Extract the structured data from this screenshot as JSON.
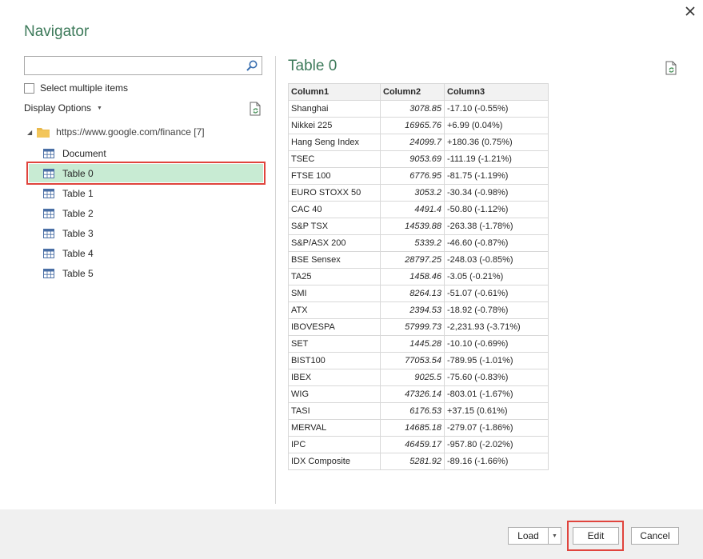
{
  "dialog": {
    "title": "Navigator",
    "close_glyph": "✕"
  },
  "left_pane": {
    "search": {
      "value": "",
      "placeholder": ""
    },
    "select_multiple_label": "Select multiple items",
    "display_options_label": "Display Options",
    "tree": {
      "root_label": "https://www.google.com/finance [7]",
      "items": [
        {
          "label": "Document"
        },
        {
          "label": "Table 0",
          "selected": true
        },
        {
          "label": "Table 1"
        },
        {
          "label": "Table 2"
        },
        {
          "label": "Table 3"
        },
        {
          "label": "Table 4"
        },
        {
          "label": "Table 5"
        }
      ]
    }
  },
  "preview": {
    "title": "Table 0",
    "columns": [
      "Column1",
      "Column2",
      "Column3"
    ],
    "rows": [
      [
        "Shanghai",
        "3078.85",
        "-17.10 (-0.55%)"
      ],
      [
        "Nikkei 225",
        "16965.76",
        "+6.99 (0.04%)"
      ],
      [
        "Hang Seng Index",
        "24099.7",
        "+180.36 (0.75%)"
      ],
      [
        "TSEC",
        "9053.69",
        "-111.19 (-1.21%)"
      ],
      [
        "FTSE 100",
        "6776.95",
        "-81.75 (-1.19%)"
      ],
      [
        "EURO STOXX 50",
        "3053.2",
        "-30.34 (-0.98%)"
      ],
      [
        "CAC 40",
        "4491.4",
        "-50.80 (-1.12%)"
      ],
      [
        "S&P TSX",
        "14539.88",
        "-263.38 (-1.78%)"
      ],
      [
        "S&P/ASX 200",
        "5339.2",
        "-46.60 (-0.87%)"
      ],
      [
        "BSE Sensex",
        "28797.25",
        "-248.03 (-0.85%)"
      ],
      [
        "TA25",
        "1458.46",
        "-3.05 (-0.21%)"
      ],
      [
        "SMI",
        "8264.13",
        "-51.07 (-0.61%)"
      ],
      [
        "ATX",
        "2394.53",
        "-18.92 (-0.78%)"
      ],
      [
        "IBOVESPA",
        "57999.73",
        "-2,231.93 (-3.71%)"
      ],
      [
        "SET",
        "1445.28",
        "-10.10 (-0.69%)"
      ],
      [
        "BIST100",
        "77053.54",
        "-789.95 (-1.01%)"
      ],
      [
        "IBEX",
        "9025.5",
        "-75.60 (-0.83%)"
      ],
      [
        "WIG",
        "47326.14",
        "-803.01 (-1.67%)"
      ],
      [
        "TASI",
        "6176.53",
        "+37.15 (0.61%)"
      ],
      [
        "MERVAL",
        "14685.18",
        "-279.07 (-1.86%)"
      ],
      [
        "IPC",
        "46459.17",
        "-957.80 (-2.02%)"
      ],
      [
        "IDX Composite",
        "5281.92",
        "-89.16 (-1.66%)"
      ]
    ]
  },
  "footer": {
    "load_label": "Load",
    "edit_label": "Edit",
    "cancel_label": "Cancel"
  },
  "colors": {
    "title_green": "#3d7a5a",
    "selected_row": "#c8ebd3",
    "highlight_red": "#e0443d",
    "footer_bg": "#f0f0f0"
  },
  "icons": {
    "search": "search-icon",
    "refresh": "refresh-icon",
    "folder": "folder-icon",
    "table": "table-icon",
    "close": "close-icon"
  }
}
